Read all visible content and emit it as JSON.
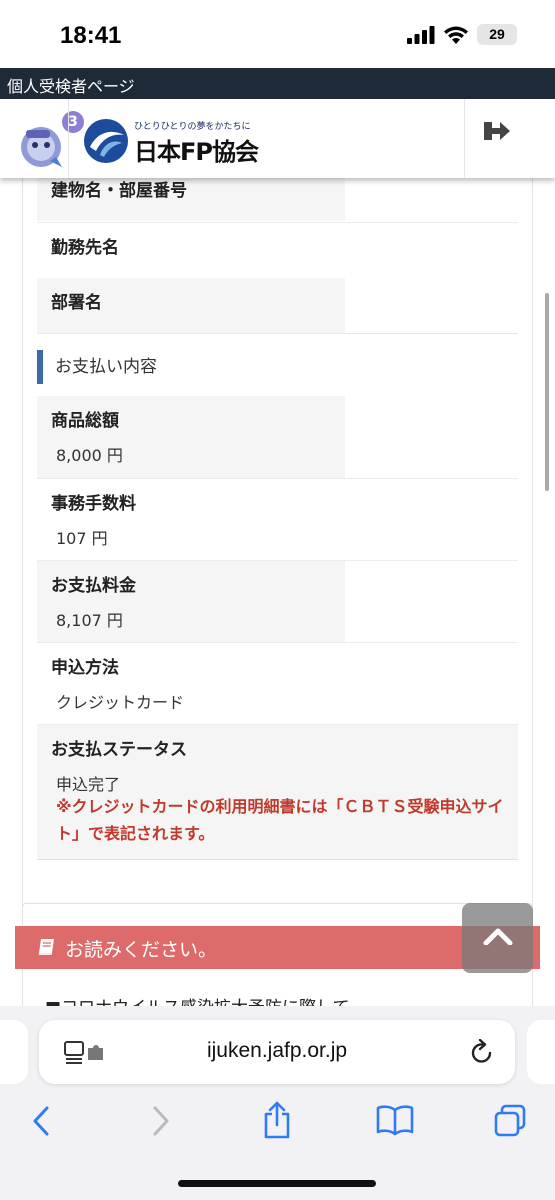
{
  "status_bar": {
    "time": "18:41",
    "battery": "29",
    "icons": [
      "signal-icon",
      "wifi-icon",
      "battery-icon"
    ]
  },
  "site": {
    "strip_title": "個人受検者ページ",
    "notification_count": "3",
    "logo_tagline": "ひとりひとりの夢をかたちに",
    "logo_name": "日本FP協会",
    "icons": [
      "mascot-icon",
      "logo-icon",
      "logout-icon"
    ]
  },
  "fields": [
    {
      "label": "建物名・部屋番号"
    },
    {
      "label": "勤務先名"
    },
    {
      "label": "部署名"
    }
  ],
  "payment": {
    "section_title": "お支払い内容",
    "rows": [
      {
        "label": "商品総額",
        "value": "8,000 円"
      },
      {
        "label": "事務手数料",
        "value": "107 円"
      },
      {
        "label": "お支払料金",
        "value": "8,107 円"
      },
      {
        "label": "申込方法",
        "value": "クレジットカード"
      },
      {
        "label": "お支払ステータス",
        "value": "申込完了"
      }
    ],
    "note": "※クレジットカードの利用明細書には「ＣＢＴＳ受験申込サイト」で表記されます。"
  },
  "notice": {
    "title": "お読みください。",
    "first_item": "■コロナウイルス感染拡大予防に際して",
    "accent_color": "#de6b6b"
  },
  "browser": {
    "url": "ijuken.jafp.or.jp",
    "toolbar": [
      "back-icon",
      "forward-icon",
      "share-icon",
      "bookmarks-icon",
      "tabs-icon"
    ]
  },
  "colors": {
    "header_strip": "#1f2a38",
    "section_accent": "#3c6ea5",
    "note_red": "#c0392b"
  }
}
